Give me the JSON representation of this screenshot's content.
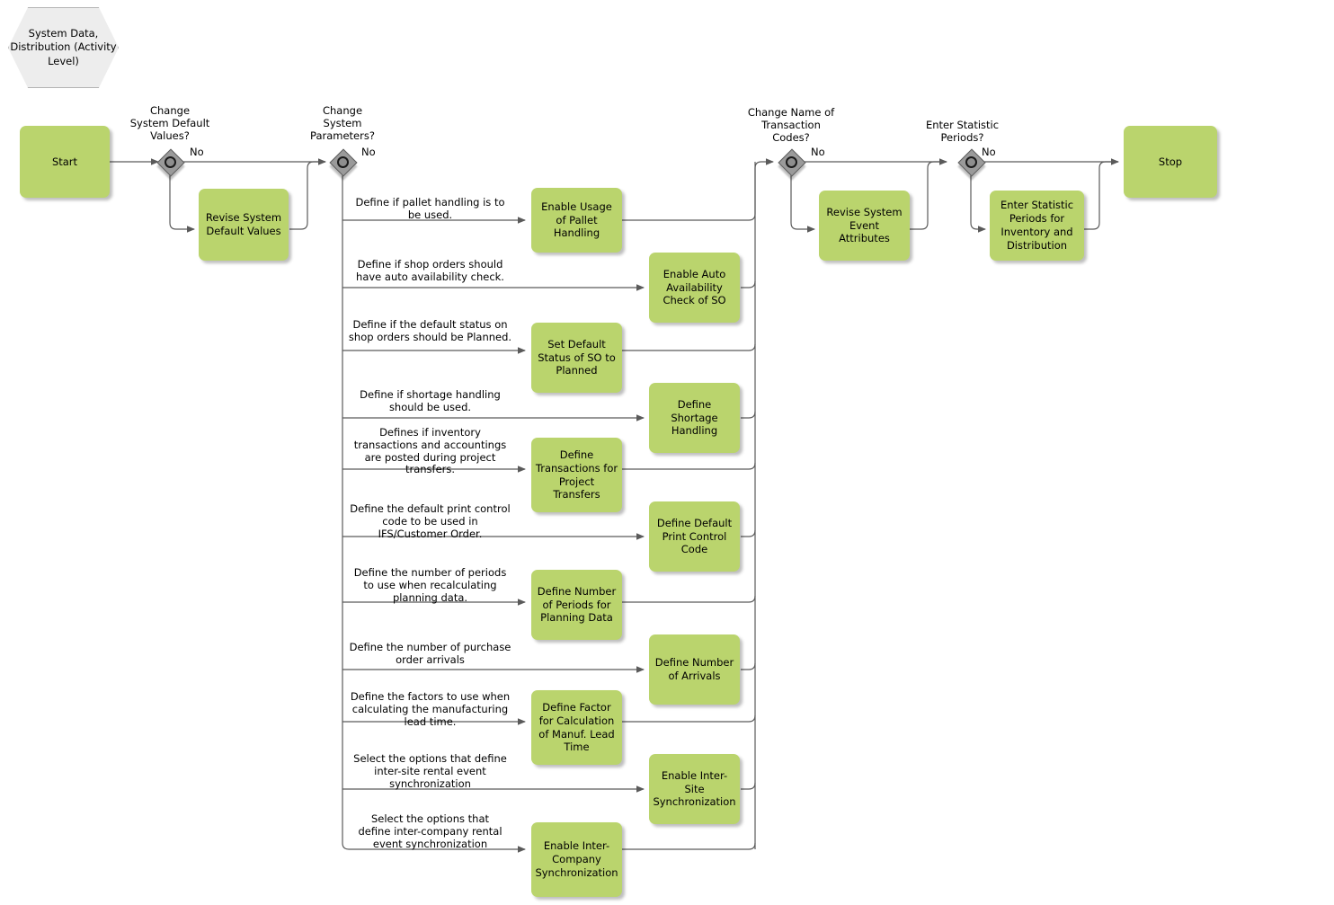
{
  "diagram": {
    "title": "System Data, Distribution (Activity Level)",
    "type": "flowchart",
    "colors": {
      "activity_fill": "#bad46d",
      "header_fill": "#ededed",
      "decision_fill": "#9a9a9a",
      "line": "#555555",
      "text": "#000000"
    }
  },
  "header": {
    "label": "System Data,\nDistribution\n(Activity Level)"
  },
  "terminators": {
    "start": "Start",
    "stop": "Stop"
  },
  "decisions": [
    {
      "id": "d1",
      "question": "Change\nSystem Default\nValues?",
      "no_label": "No"
    },
    {
      "id": "d2",
      "question": "Change\nSystem\nParameters?",
      "no_label": "No"
    },
    {
      "id": "d3",
      "question": "Change Name of\nTransaction\nCodes?",
      "no_label": "No"
    },
    {
      "id": "d4",
      "question": "Enter Statistic\nPeriods?",
      "no_label": "No"
    }
  ],
  "yes_activities": [
    {
      "id": "a1",
      "label": "Revise System\nDefault Values"
    },
    {
      "id": "a2",
      "label": "Revise System\nEvent Attributes"
    },
    {
      "id": "a3",
      "label": "Enter Statistic\nPeriods for\nInventory and\nDistribution"
    }
  ],
  "parameter_branches": [
    {
      "index": 1,
      "condition": "Define if pallet handling is to\nbe used.",
      "activity": "Enable Usage of\nPallet Handling",
      "column": "near"
    },
    {
      "index": 2,
      "condition": "Define if shop orders should\nhave auto availability check.",
      "activity": "Enable Auto\nAvailability\nCheck of SO",
      "column": "far"
    },
    {
      "index": 3,
      "condition": "Define if the default status on\nshop orders should be Planned.",
      "activity": "Set Default\nStatus of SO to\nPlanned",
      "column": "near"
    },
    {
      "index": 4,
      "condition": "Define if shortage handling\nshould be used.",
      "activity": "Define Shortage\nHandling",
      "column": "far"
    },
    {
      "index": 5,
      "condition": "Defines if inventory\ntransactions and accountings\nare posted during project\ntransfers.",
      "activity": "Define\nTransactions for\nProject\nTransfers",
      "column": "near"
    },
    {
      "index": 6,
      "condition": "Define the default print control\ncode to be used in\nIFS/Customer Order.",
      "activity": "Define Default\nPrint Control\nCode",
      "column": "far"
    },
    {
      "index": 7,
      "condition": "Define the number of periods\nto use when recalculating\nplanning data.",
      "activity": "Define Number\nof Periods for\nPlanning Data",
      "column": "near"
    },
    {
      "index": 8,
      "condition": "Define the number of purchase\norder arrivals",
      "activity": "Define Number\nof Arrivals",
      "column": "far"
    },
    {
      "index": 9,
      "condition": "Define the factors to use when\ncalculating the manufacturing\nlead time.",
      "activity": "Define Factor\nfor Calculation\nof Manuf. Lead\nTime",
      "column": "near"
    },
    {
      "index": 10,
      "condition": "Select the options that define\ninter-site rental event\nsynchronization",
      "activity": "Enable\nInter-Site\nSynchronization",
      "column": "far"
    },
    {
      "index": 11,
      "condition": "Select the options that\ndefine inter-company rental\nevent synchronization",
      "activity": "Enable Inter-\nCompany\nSynchronization",
      "column": "near"
    }
  ]
}
